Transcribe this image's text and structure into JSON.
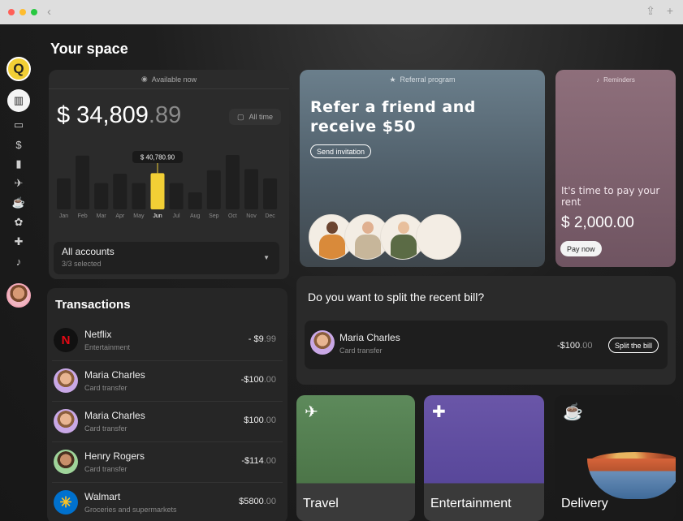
{
  "browser": {
    "dot_colors": [
      "#ff5f57",
      "#febc2e",
      "#28c840"
    ],
    "back_icon": "chevron-left-icon",
    "right_icons": [
      "share-icon",
      "plus-icon"
    ]
  },
  "sidebar": {
    "logo_letter": "Q",
    "items": [
      {
        "icon": "chart-icon",
        "glyph": "▥",
        "active": true
      },
      {
        "icon": "card-icon",
        "glyph": "▭"
      },
      {
        "icon": "dollar-icon",
        "glyph": "$"
      },
      {
        "icon": "bag-icon",
        "glyph": "▮"
      },
      {
        "icon": "plane-icon",
        "glyph": "✈"
      },
      {
        "icon": "food-icon",
        "glyph": "☕"
      },
      {
        "icon": "paw-icon",
        "glyph": "✿"
      },
      {
        "icon": "puzzle-icon",
        "glyph": "✚"
      },
      {
        "icon": "bell-icon",
        "glyph": "♪"
      }
    ]
  },
  "page": {
    "title": "Your space"
  },
  "balance": {
    "header": "Available now",
    "dollars": "$ 34,809",
    "cents": ".89",
    "period_button": "All time"
  },
  "chart_data": {
    "type": "bar",
    "categories": [
      "Jan",
      "Feb",
      "Mar",
      "Apr",
      "May",
      "Jun",
      "Jul",
      "Aug",
      "Sep",
      "Oct",
      "Nov",
      "Dec"
    ],
    "values": [
      0.53,
      0.92,
      0.45,
      0.61,
      0.45,
      0.62,
      0.45,
      0.29,
      0.67,
      0.93,
      0.69,
      0.53
    ],
    "highlight_index": 5,
    "highlight_label": "$ 40,780.90",
    "highlight_color": "#f2cf35",
    "bar_color": "#1f1f1f",
    "title": "",
    "xlabel": "",
    "ylabel": ""
  },
  "accounts": {
    "title": "All accounts",
    "subtitle": "3/3 selected"
  },
  "transactions": {
    "title": "Transactions",
    "rows": [
      {
        "name": "Netflix",
        "category": "Entertainment",
        "amount": "- $9",
        "cents": ".99",
        "avatar": "netflix-logo"
      },
      {
        "name": "Maria Charles",
        "category": "Card transfer",
        "amount": "-$100",
        "cents": ".00",
        "avatar": "avatar"
      },
      {
        "name": "Maria Charles",
        "category": "Card transfer",
        "amount": "$100",
        "cents": ".00",
        "avatar": "avatar"
      },
      {
        "name": "Henry Rogers",
        "category": "Card transfer",
        "amount": "-$114",
        "cents": ".00",
        "avatar": "avatar"
      },
      {
        "name": "Walmart",
        "category": "Groceries and supermarkets",
        "amount": "$5800",
        "cents": ".00",
        "avatar": "walmart-logo"
      }
    ]
  },
  "referral": {
    "header": "Referral program",
    "headline": "Refer a friend and receive $50",
    "button": "Send invitation"
  },
  "reminders": {
    "header": "Reminders",
    "text": "It's time to pay your rent",
    "amount": "$ 2,000.00",
    "button": "Pay now"
  },
  "split": {
    "title": "Do you want to split the recent bill?",
    "name": "Maria Charles",
    "subtitle": "Card transfer",
    "amount": "-$100",
    "cents": ".00",
    "button": "Split the bill"
  },
  "categories": [
    {
      "label": "Travel",
      "icon": "plane-icon",
      "glyph": "✈"
    },
    {
      "label": "Entertainment",
      "icon": "puzzle-icon",
      "glyph": "✚"
    },
    {
      "label": "Delivery",
      "icon": "food-icon",
      "glyph": "☕"
    }
  ]
}
